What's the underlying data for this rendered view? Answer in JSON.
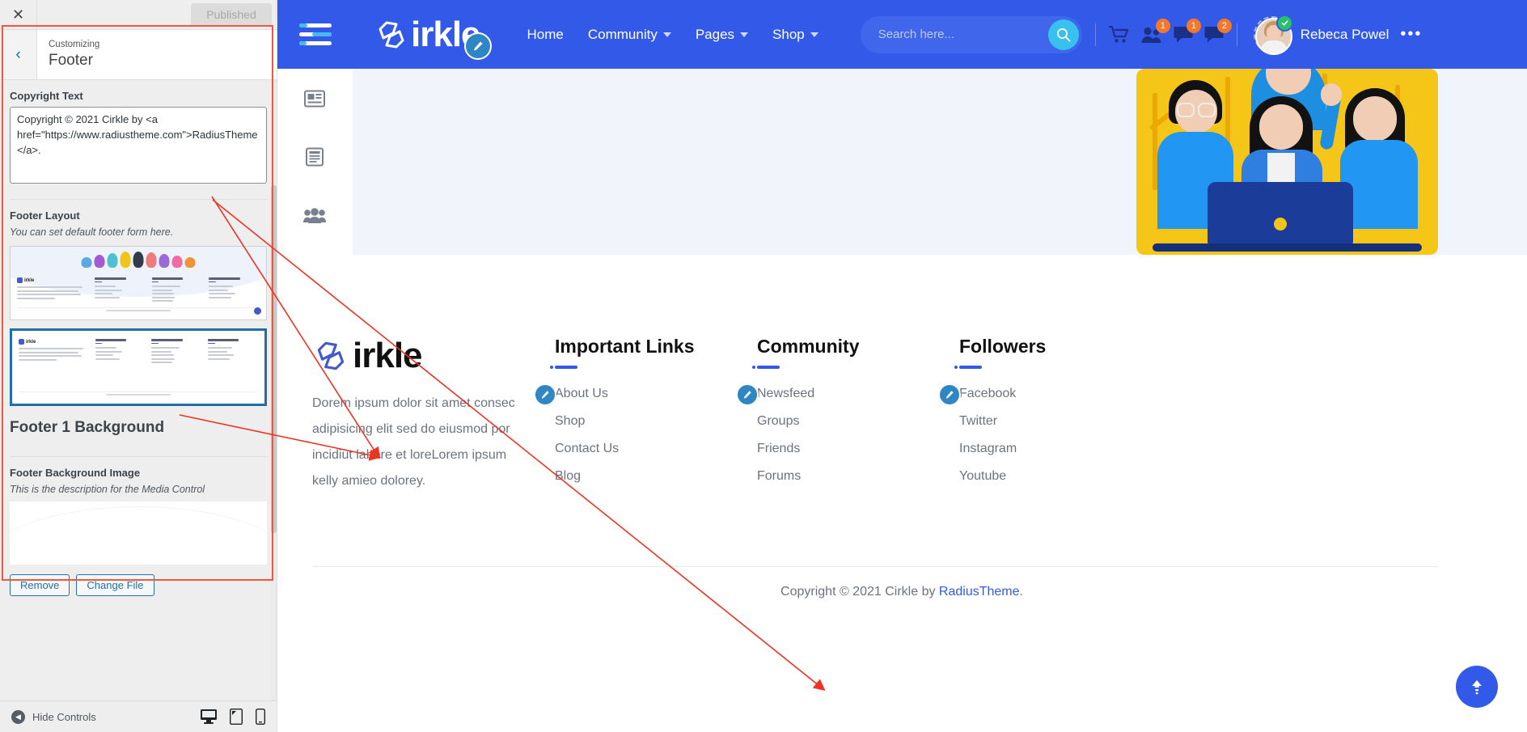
{
  "customizer": {
    "close_label": "✕",
    "publish_label": "Published",
    "back_label": "‹",
    "subtitle": "Customizing",
    "title": "Footer",
    "copyright_field": {
      "label": "Copyright Text",
      "value": "Copyright © 2021 Cirkle by <a href=\"https://www.radiustheme.com\">RadiusTheme</a>."
    },
    "footer_layout": {
      "label": "Footer Layout",
      "description": "You can set default footer form here.",
      "options": [
        {
          "name": "footer-layout-1",
          "selected": false
        },
        {
          "name": "footer-layout-2",
          "selected": true
        }
      ]
    },
    "background_section": {
      "title": "Footer 1 Background",
      "label": "Footer Background Image",
      "description": "This is the description for the Media Control",
      "remove_label": "Remove",
      "change_label": "Change File"
    },
    "footerbar": {
      "hide_controls_label": "Hide Controls",
      "devices": [
        "desktop-icon",
        "tablet-icon",
        "mobile-icon"
      ]
    }
  },
  "site": {
    "header": {
      "logo_text": "irkle",
      "nav": [
        {
          "label": "Home",
          "has_caret": false
        },
        {
          "label": "Community",
          "has_caret": true
        },
        {
          "label": "Pages",
          "has_caret": true
        },
        {
          "label": "Shop",
          "has_caret": true
        }
      ],
      "search": {
        "placeholder": "Search here...",
        "value": ""
      },
      "icons": [
        {
          "name": "cart-icon",
          "badge": ""
        },
        {
          "name": "friends-icon",
          "badge": "1"
        },
        {
          "name": "messages-icon",
          "badge": "1"
        },
        {
          "name": "notifications-icon",
          "badge": "2"
        }
      ],
      "user": {
        "name": "Rebeca Powel",
        "status": "online",
        "more": "•••"
      }
    },
    "rail": [
      "newsfeed-icon",
      "pages-icon",
      "groups-icon",
      "members-icon",
      "photos-icon",
      "videos-icon",
      "forums-icon",
      "shop-icon"
    ],
    "footer": {
      "brand_text": "irkle",
      "brand_desc": "Dorem ipsum dolor sit amet consec adipisicing elit sed do eiusmod por incidiut labore et loreLorem ipsum kelly amieo dolorey.",
      "columns": [
        {
          "title": "Important Links",
          "items": [
            "About Us",
            "Shop",
            "Contact Us",
            "Blog"
          ]
        },
        {
          "title": "Community",
          "items": [
            "Newsfeed",
            "Groups",
            "Friends",
            "Forums"
          ]
        },
        {
          "title": "Followers",
          "items": [
            "Facebook",
            "Twitter",
            "Instagram",
            "Youtube"
          ]
        }
      ],
      "copyright_prefix": "Copyright © 2021 Cirkle by ",
      "copyright_link": "RadiusTheme",
      "copyright_suffix": "."
    },
    "scroll_top": "scroll-to-top-icon"
  },
  "colors": {
    "brand_blue": "#3259e8",
    "accent_cyan": "#37c0f0",
    "badge_orange": "#f2792b",
    "online_green": "#28c26a",
    "annotation_red": "#ee3322",
    "selected_border": "#1f6fa8"
  }
}
